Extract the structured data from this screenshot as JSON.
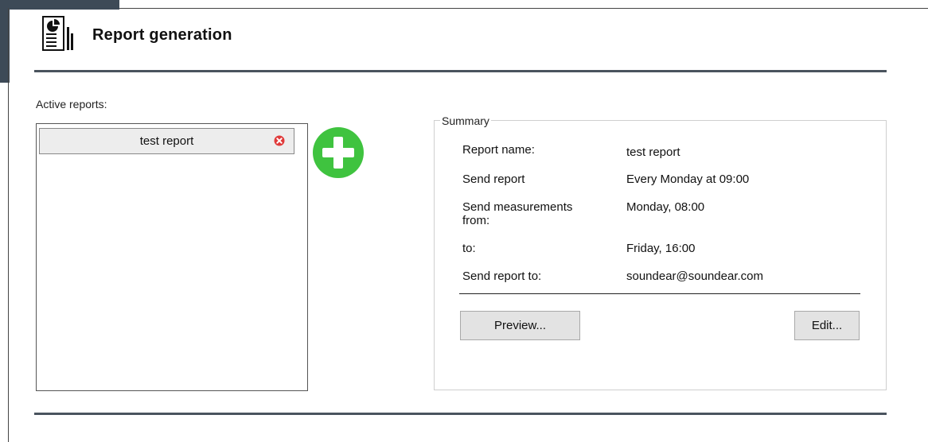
{
  "header": {
    "title": "Report generation",
    "icon": "report-document-icon"
  },
  "active_reports": {
    "label": "Active reports:",
    "items": [
      {
        "name": "test report"
      }
    ],
    "add_icon": "plus-circle-icon",
    "remove_icon": "close-circle-icon"
  },
  "summary": {
    "legend": "Summary",
    "rows": [
      {
        "label": "Report name:",
        "value": "test report"
      },
      {
        "label": "Send report",
        "value": "Every Monday at 09:00"
      },
      {
        "label": "Send measurements from:",
        "value": "Monday, 08:00"
      },
      {
        "label": "to:",
        "value": "Friday, 16:00"
      },
      {
        "label": "Send report to:",
        "value": "soundear@soundear.com"
      }
    ],
    "preview_label": "Preview...",
    "edit_label": "Edit..."
  },
  "colors": {
    "accent_green": "#3fc33f",
    "rule": "#4a545e",
    "remove_red": "#e03a3a"
  }
}
